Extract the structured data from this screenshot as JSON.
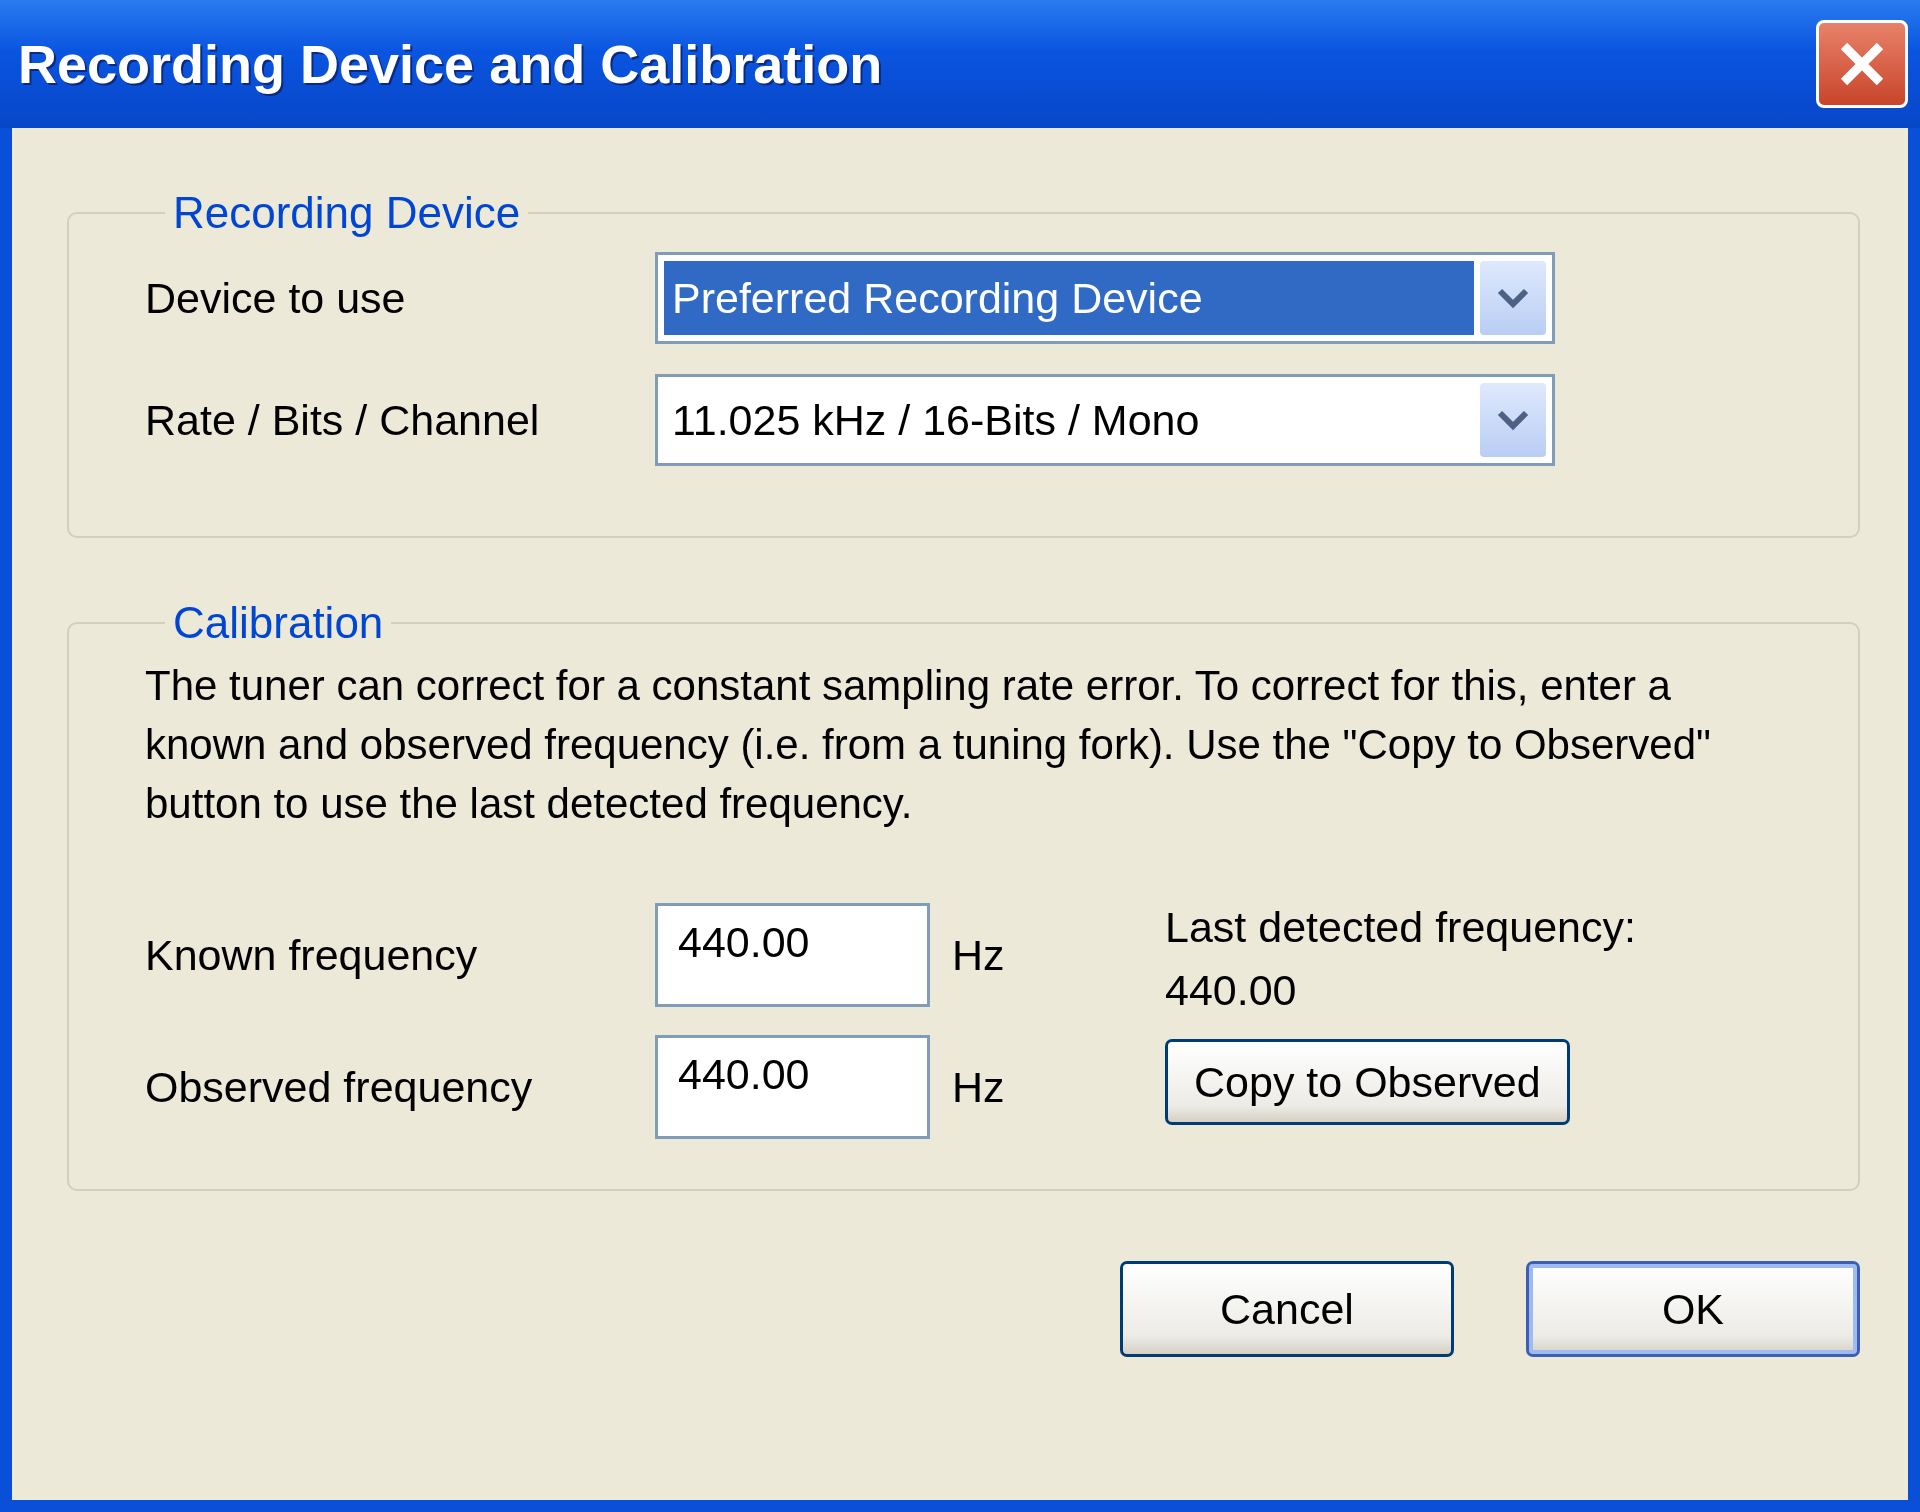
{
  "window": {
    "title": "Recording Device and Calibration"
  },
  "recording_device": {
    "legend": "Recording Device",
    "fields": [
      {
        "label": "Device to use",
        "value": "Preferred Recording Device",
        "highlighted": true
      },
      {
        "label": "Rate / Bits / Channel",
        "value": "11.025 kHz / 16-Bits / Mono",
        "highlighted": false
      }
    ]
  },
  "calibration": {
    "legend": "Calibration",
    "description": "The tuner can correct for a constant sampling rate error.  To correct for this, enter a known and observed frequency (i.e. from a tuning fork). Use the \"Copy to Observed\" button to use the last detected frequency.",
    "inputs": [
      {
        "label": "Known frequency",
        "value": "440.00",
        "unit": "Hz"
      },
      {
        "label": "Observed frequency",
        "value": "440.00",
        "unit": "Hz"
      }
    ],
    "last_detected_label": "Last detected frequency:",
    "last_detected_value": "440.00",
    "copy_button": "Copy to Observed"
  },
  "buttons": [
    {
      "label": "Cancel",
      "default": false
    },
    {
      "label": "OK",
      "default": true
    }
  ]
}
